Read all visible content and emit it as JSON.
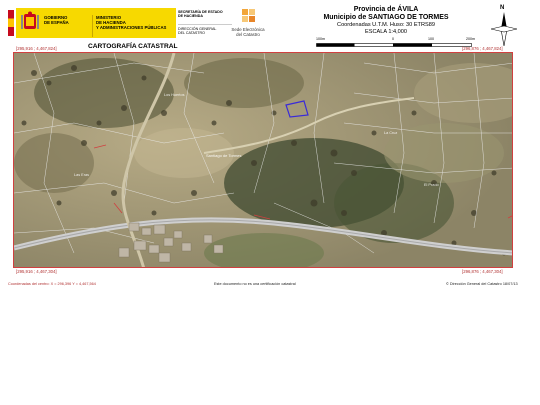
{
  "header": {
    "gov_line1": "GOBIERNO",
    "gov_line2": "DE ESPAÑA",
    "ministry_line1": "MINISTERIO",
    "ministry_line2": "DE HACIENDA",
    "ministry_line3": "Y ADMINISTRACIONES PÚBLICAS",
    "secretary_line1": "SECRETARÍA DE ESTADO",
    "secretary_line2": "DE HACIENDA",
    "direction_line1": "DIRECCIÓN GENERAL",
    "direction_line2": "DEL CATASTRO",
    "sede_line1": "Sede Electrónica",
    "sede_line2": "del Catastro"
  },
  "title": {
    "province": "Provincia de ÁVILA",
    "municipality": "Municipio de SANTIAGO DE TORMES",
    "coordinates": "Coordenadas U.T.M. Huso: 30 ETRS89",
    "scale": "ESCALA 1:4,000"
  },
  "scale_bar": {
    "labels": [
      "100m",
      "0",
      "100",
      "200m"
    ]
  },
  "north_label": "N",
  "section_title": "CARTOGRAFÍA CATASTRAL",
  "corners": {
    "top_left": "[295,916 ; 4,467,824]",
    "top_right": "[296,876 ; 4,467,824]",
    "bottom_left": "[295,916 ; 4,467,304]",
    "bottom_right": "[296,876 ; 4,467,304]"
  },
  "map_labels": {
    "village": "Santiago de Tormes",
    "parcel_a": "La Cruz",
    "parcel_b": "Las Eras",
    "parcel_c": "El Prado",
    "parcel_d": "Los Huertos"
  },
  "footer": {
    "left": "Coordenadas del centro: X = 296,396 Y = 4,467,564",
    "center": "Este documento no es una certificación catastral",
    "right": "© Dirección General del Catastro 18/07/13"
  },
  "colors": {
    "gov_yellow": "#f7d900",
    "border_red": "#d04040",
    "coord_red": "#b03030",
    "parcel_line": "#e8e8e8",
    "road": "#b8b8b8",
    "selected_parcel": "#3a2bd8"
  }
}
